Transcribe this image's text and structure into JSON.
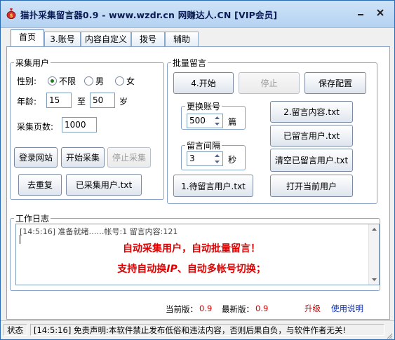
{
  "window": {
    "title": "猫扑采集留言器0.9 - www.wzdr.cn 网赚达人.CN [VIP会员]",
    "icons": {
      "app": "money-bag-icon",
      "minimize": "minimize-icon",
      "close": "close-icon"
    }
  },
  "tabs": [
    {
      "label": "首页",
      "active": true
    },
    {
      "label": "3.账号",
      "active": false
    },
    {
      "label": "内容自定义",
      "active": false
    },
    {
      "label": "拨号",
      "active": false
    },
    {
      "label": "辅助",
      "active": false
    }
  ],
  "collect": {
    "legend": "采集用户",
    "gender_label": "性别:",
    "gender_options": [
      "不限",
      "男",
      "女"
    ],
    "gender_selected": "不限",
    "age_label": "年龄:",
    "age_min": "15",
    "age_to": "至",
    "age_max": "50",
    "age_unit": "岁",
    "pages_label": "采集页数:",
    "pages_value": "1000",
    "buttons": {
      "login_site": "登录网站",
      "start_collect": "开始采集",
      "stop_collect": "停止采集",
      "dedupe": "去重复",
      "collected_users": "已采集用户.txt"
    }
  },
  "batch": {
    "legend": "批量留言",
    "start": "4.开始",
    "stop": "停止",
    "save_config": "保存配置",
    "switch_account": {
      "legend": "更换账号",
      "value": "500",
      "unit": "篇"
    },
    "interval": {
      "legend": "留言间隔",
      "value": "3",
      "unit": "秒"
    },
    "pending_users": "1.待留言用户.txt",
    "message_content": "2.留言内容.txt",
    "messaged_users": "已留言用户.txt",
    "clear_messaged": "清空已留言用户.txt",
    "open_current_user": "打开当前用户"
  },
  "log": {
    "legend": "工作日志",
    "line": "[14:5:16] 准备就绪……帐号:1 留言内容:121",
    "promo_line1": "自动采集用户，自动批量留言！",
    "promo_line2_prefix": "支持自动换",
    "promo_line2_ip": "IP",
    "promo_line2_suffix": "、自动多帐号切换；"
  },
  "version": {
    "current_label": "当前版：",
    "current": "0.9",
    "latest_label": "最新版：",
    "latest": "0.9",
    "upgrade": "升级",
    "help": "使用说明"
  },
  "status": {
    "label": "状态",
    "message": "[14:5:16] 免责声明:本软件禁止发布低俗和违法内容，否则后果自负，与软件作者无关!"
  },
  "colors": {
    "accent_red": "#e00000",
    "link_blue": "#1030b0",
    "upgrade_red": "#d00000"
  }
}
